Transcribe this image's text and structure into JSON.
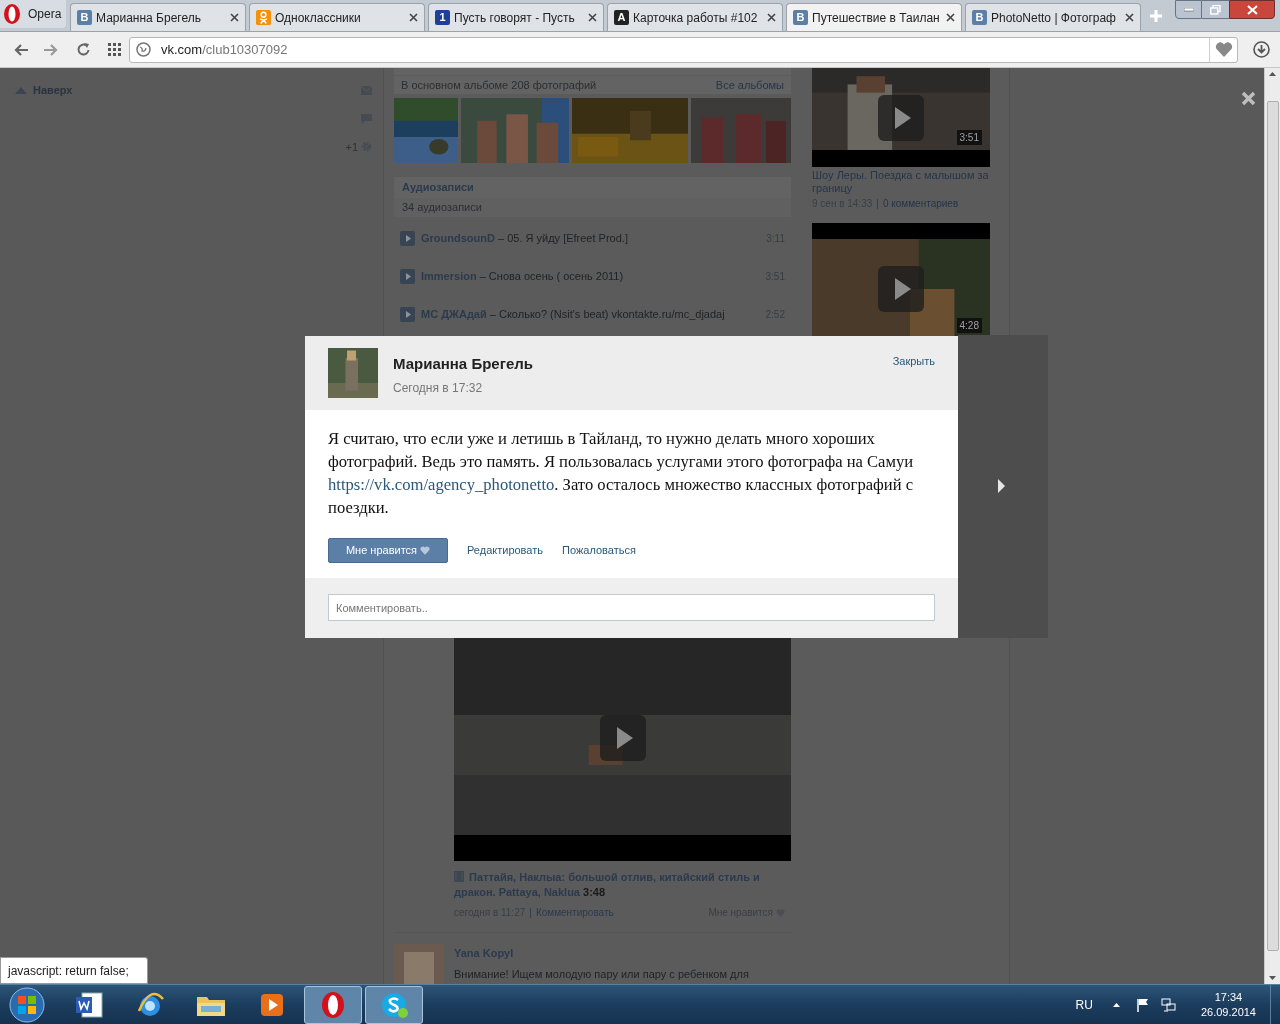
{
  "browser": {
    "menu_label": "Opera",
    "tabs": [
      {
        "title": "Марианна Брегель",
        "icon": {
          "kind": "vk",
          "text": "В"
        },
        "selected": false
      },
      {
        "title": "Одноклассники",
        "icon": {
          "kind": "ok"
        },
        "selected": false
      },
      {
        "title": "Пусть говорят - Пусть",
        "icon": {
          "kind": "channel",
          "text": "1"
        },
        "selected": false
      },
      {
        "title": "Карточка работы #102",
        "icon": {
          "kind": "dark",
          "text": "A"
        },
        "selected": false
      },
      {
        "title": "Путешествие в Таилан",
        "icon": {
          "kind": "vk",
          "text": "В"
        },
        "selected": true
      },
      {
        "title": "PhotoNetto | Фотограф",
        "icon": {
          "kind": "vk",
          "text": "В"
        },
        "selected": false
      }
    ],
    "address": {
      "host": "vk.com",
      "path": "/club10307092"
    }
  },
  "sidebar": {
    "back_to_top": "Наверх",
    "counter": "+1"
  },
  "photos": {
    "summary": "В основном альбоме 208 фотографий",
    "all_albums": "Все альбомы"
  },
  "audio": {
    "title": "Аудиозаписи",
    "count": "34 аудиозаписи",
    "tracks": [
      {
        "artist": "GroundsounD",
        "title": " – 05. Я уйду [Efreet Prod.]",
        "duration": "3:11"
      },
      {
        "artist": "Immersion",
        "title": " – Снова осень ( осень 2011)",
        "duration": "3:51"
      },
      {
        "artist": "MC ДЖАдай",
        "title": " – Сколько? (Nsit's beat) vkontakte.ru/mc_djadaj",
        "duration": "2:52"
      }
    ]
  },
  "post_video": {
    "title": "Паттайя, Наклыа: большой отлив, китайский стиль и дракон. Pattaya, Naklua",
    "duration": "3:48",
    "date": "сегодня в 11:27",
    "separator": "|",
    "comment": "Комментировать",
    "like": "Мне нравится"
  },
  "next_post": {
    "author": "Yana Kopyl",
    "text": "Внимание! Ищем молодую пару или пару с ребенком для"
  },
  "videos": [
    {
      "duration": "3:51",
      "title": "Шоу Леры. Поездка с малышом за границу",
      "date": "9 сен в 14:33",
      "separator": "|",
      "comments": "0 комментариев"
    },
    {
      "duration": "4:28"
    }
  ],
  "modal": {
    "author": "Марианна Брегель",
    "time": "Сегодня в 17:32",
    "close": "Закрыть",
    "text_before": "Я считаю, что если уже и летишь в Тайланд, то нужно делать много хороших фотографий. Ведь это память. Я пользовалась услугами этого фотографа на Самуи ",
    "link": "https://vk.com/agency_photonetto",
    "text_after": ". Зато осталось множество классных фотографий с поездки.",
    "like": "Мне нравится",
    "edit": "Редактировать",
    "report": "Пожаловаться",
    "comment_placeholder": "Комментировать.."
  },
  "status_tooltip": "javascript: return false;",
  "taskbar": {
    "apps": [
      {
        "kind": "word",
        "active": false
      },
      {
        "kind": "ie",
        "active": false
      },
      {
        "kind": "explorer",
        "active": false
      },
      {
        "kind": "media",
        "active": false
      },
      {
        "kind": "opera",
        "active": true
      },
      {
        "kind": "skype",
        "active": true
      }
    ],
    "language": "RU",
    "time": "17:34",
    "date": "26.09.2014"
  }
}
